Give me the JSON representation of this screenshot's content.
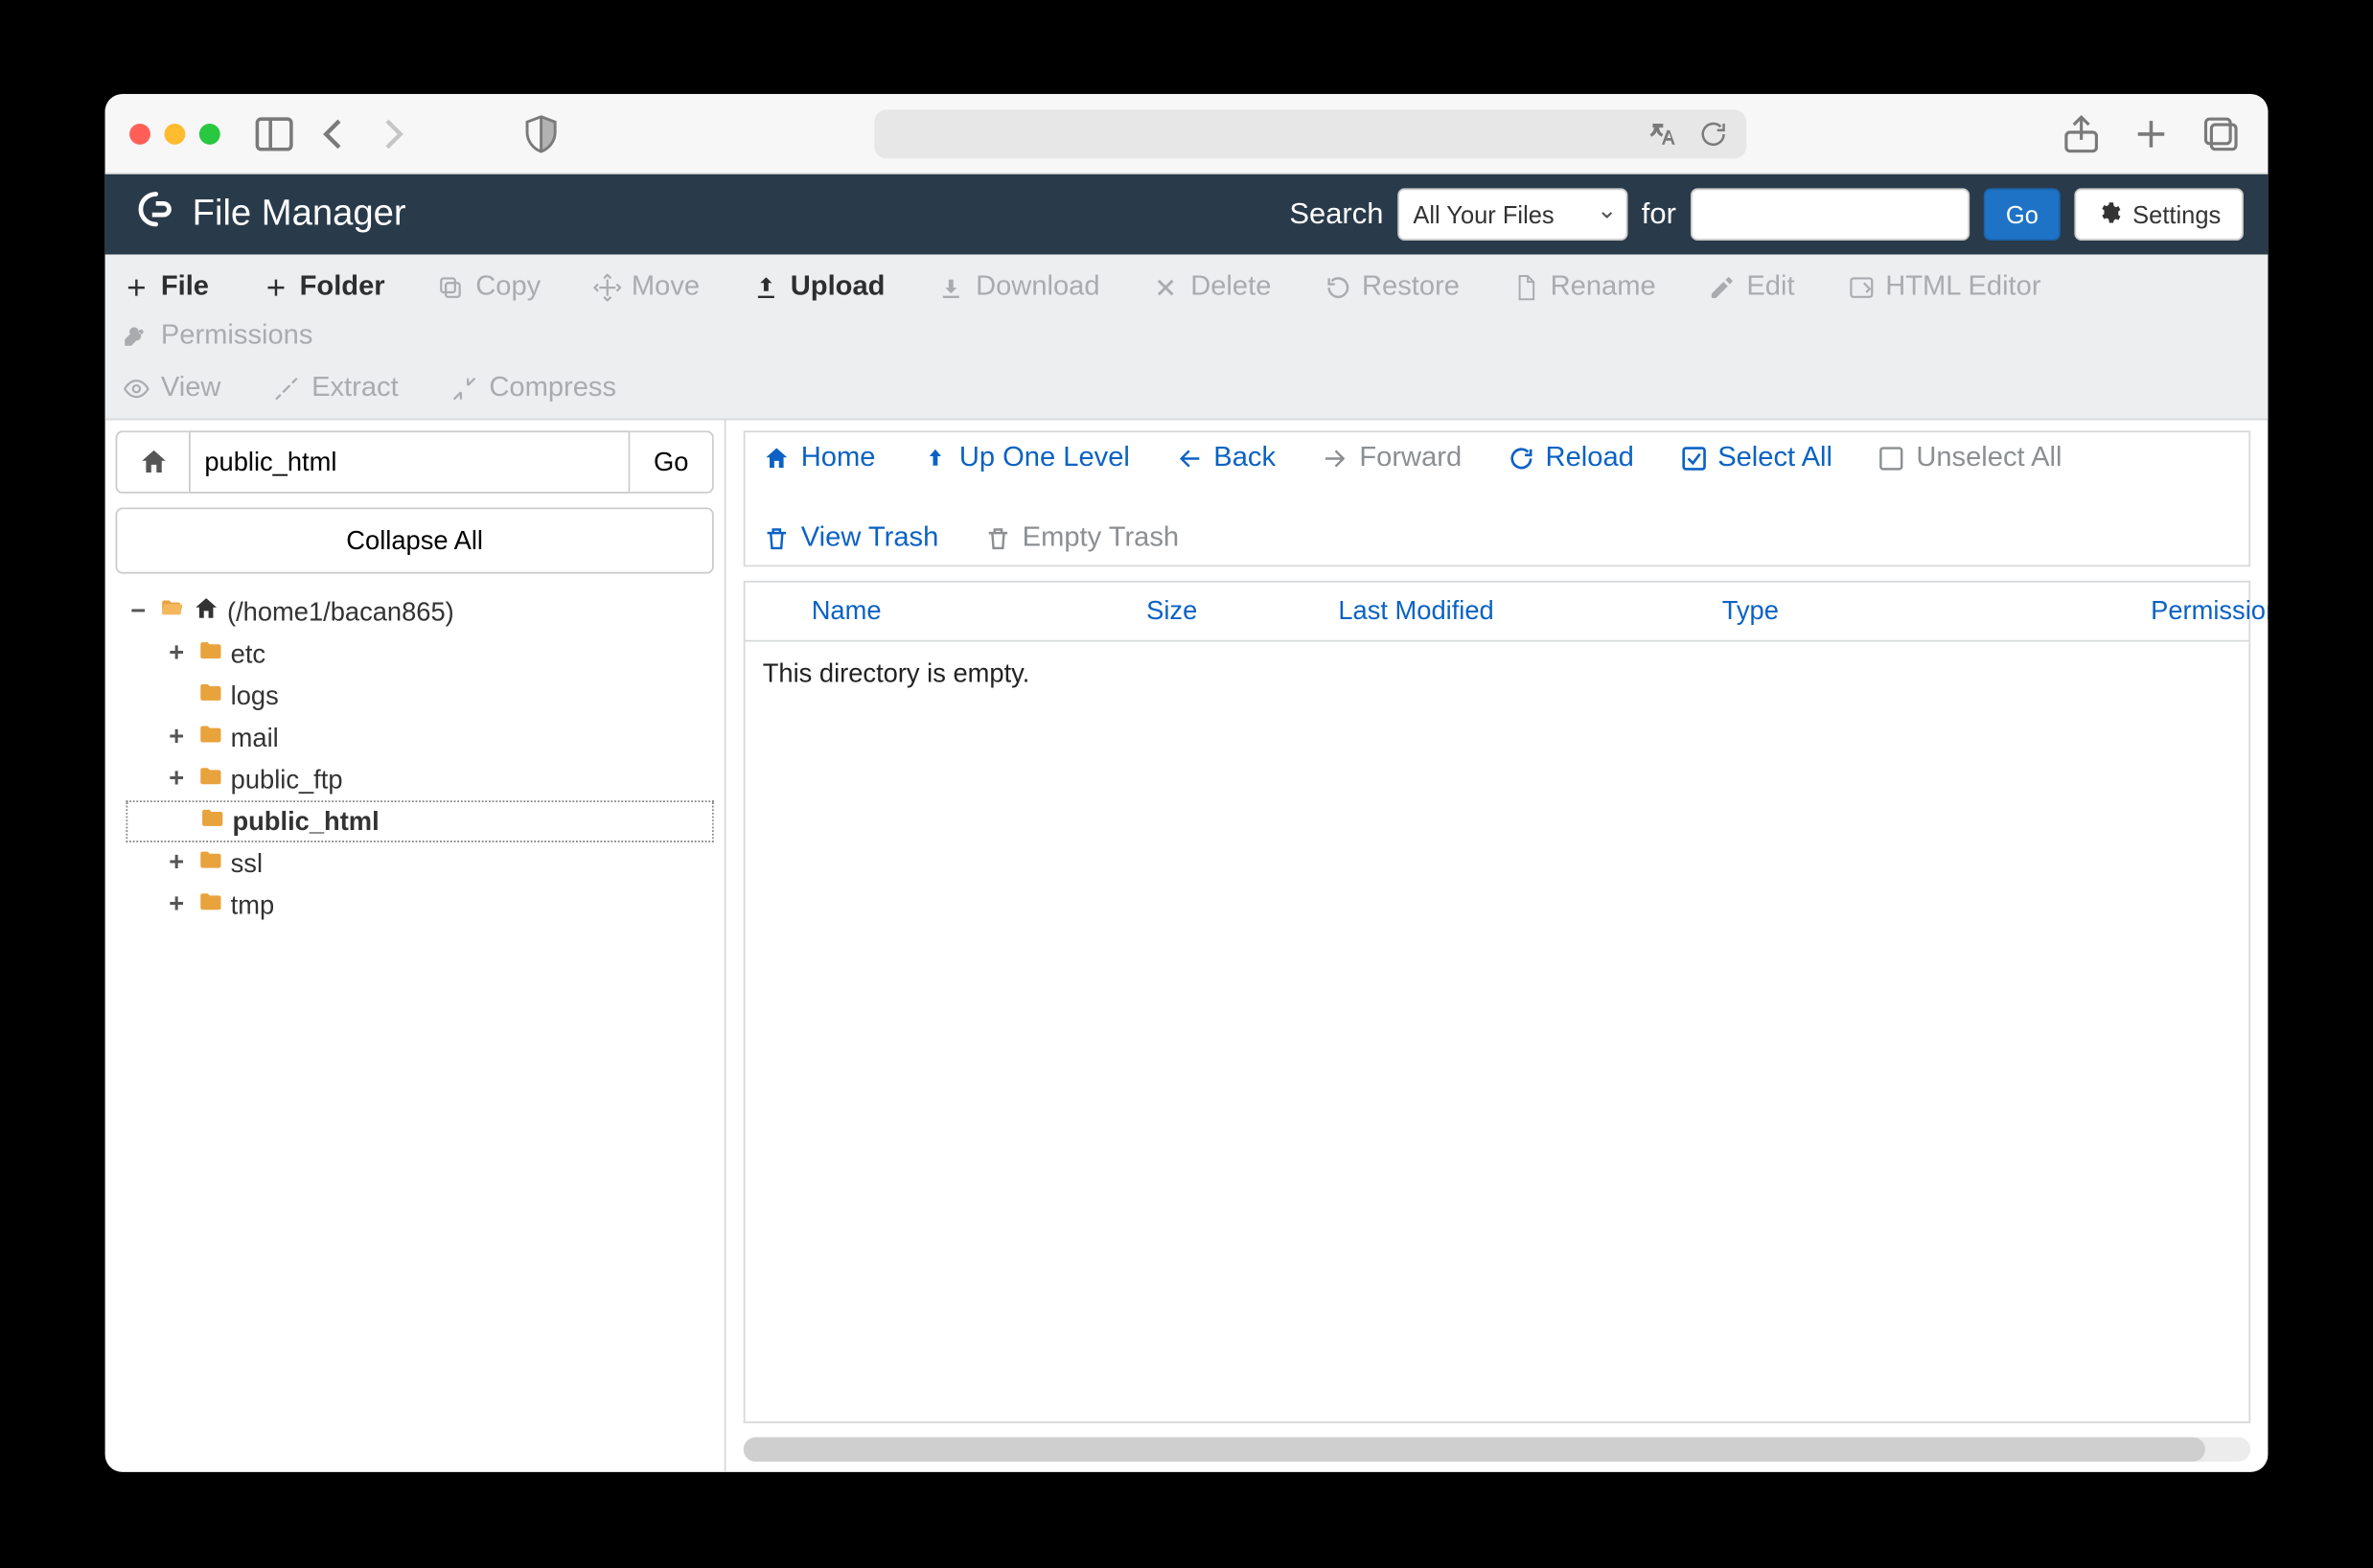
{
  "app": {
    "title": "File Manager"
  },
  "search": {
    "label": "Search",
    "scope_selected": "All Your Files",
    "for_label": "for",
    "query": "",
    "go_label": "Go"
  },
  "settings": {
    "label": "Settings"
  },
  "toolbar": {
    "file": "File",
    "folder": "Folder",
    "copy": "Copy",
    "move": "Move",
    "upload": "Upload",
    "download": "Download",
    "delete": "Delete",
    "restore": "Restore",
    "rename": "Rename",
    "edit": "Edit",
    "html_editor": "HTML Editor",
    "permissions": "Permissions",
    "view": "View",
    "extract": "Extract",
    "compress": "Compress"
  },
  "left": {
    "path_value": "public_html",
    "go_label": "Go",
    "collapse_label": "Collapse All",
    "root_label": "(/home1/bacan865)",
    "items": [
      {
        "label": "etc",
        "expandable": true
      },
      {
        "label": "logs",
        "expandable": false
      },
      {
        "label": "mail",
        "expandable": true
      },
      {
        "label": "public_ftp",
        "expandable": true
      },
      {
        "label": "public_html",
        "expandable": false,
        "selected": true
      },
      {
        "label": "ssl",
        "expandable": true
      },
      {
        "label": "tmp",
        "expandable": true
      }
    ]
  },
  "nav": {
    "home": "Home",
    "up": "Up One Level",
    "back": "Back",
    "forward": "Forward",
    "reload": "Reload",
    "select_all": "Select All",
    "unselect_all": "Unselect All",
    "view_trash": "View Trash",
    "empty_trash": "Empty Trash"
  },
  "columns": {
    "name": "Name",
    "size": "Size",
    "last_modified": "Last Modified",
    "type": "Type",
    "permissions": "Permission"
  },
  "empty_message": "This directory is empty."
}
